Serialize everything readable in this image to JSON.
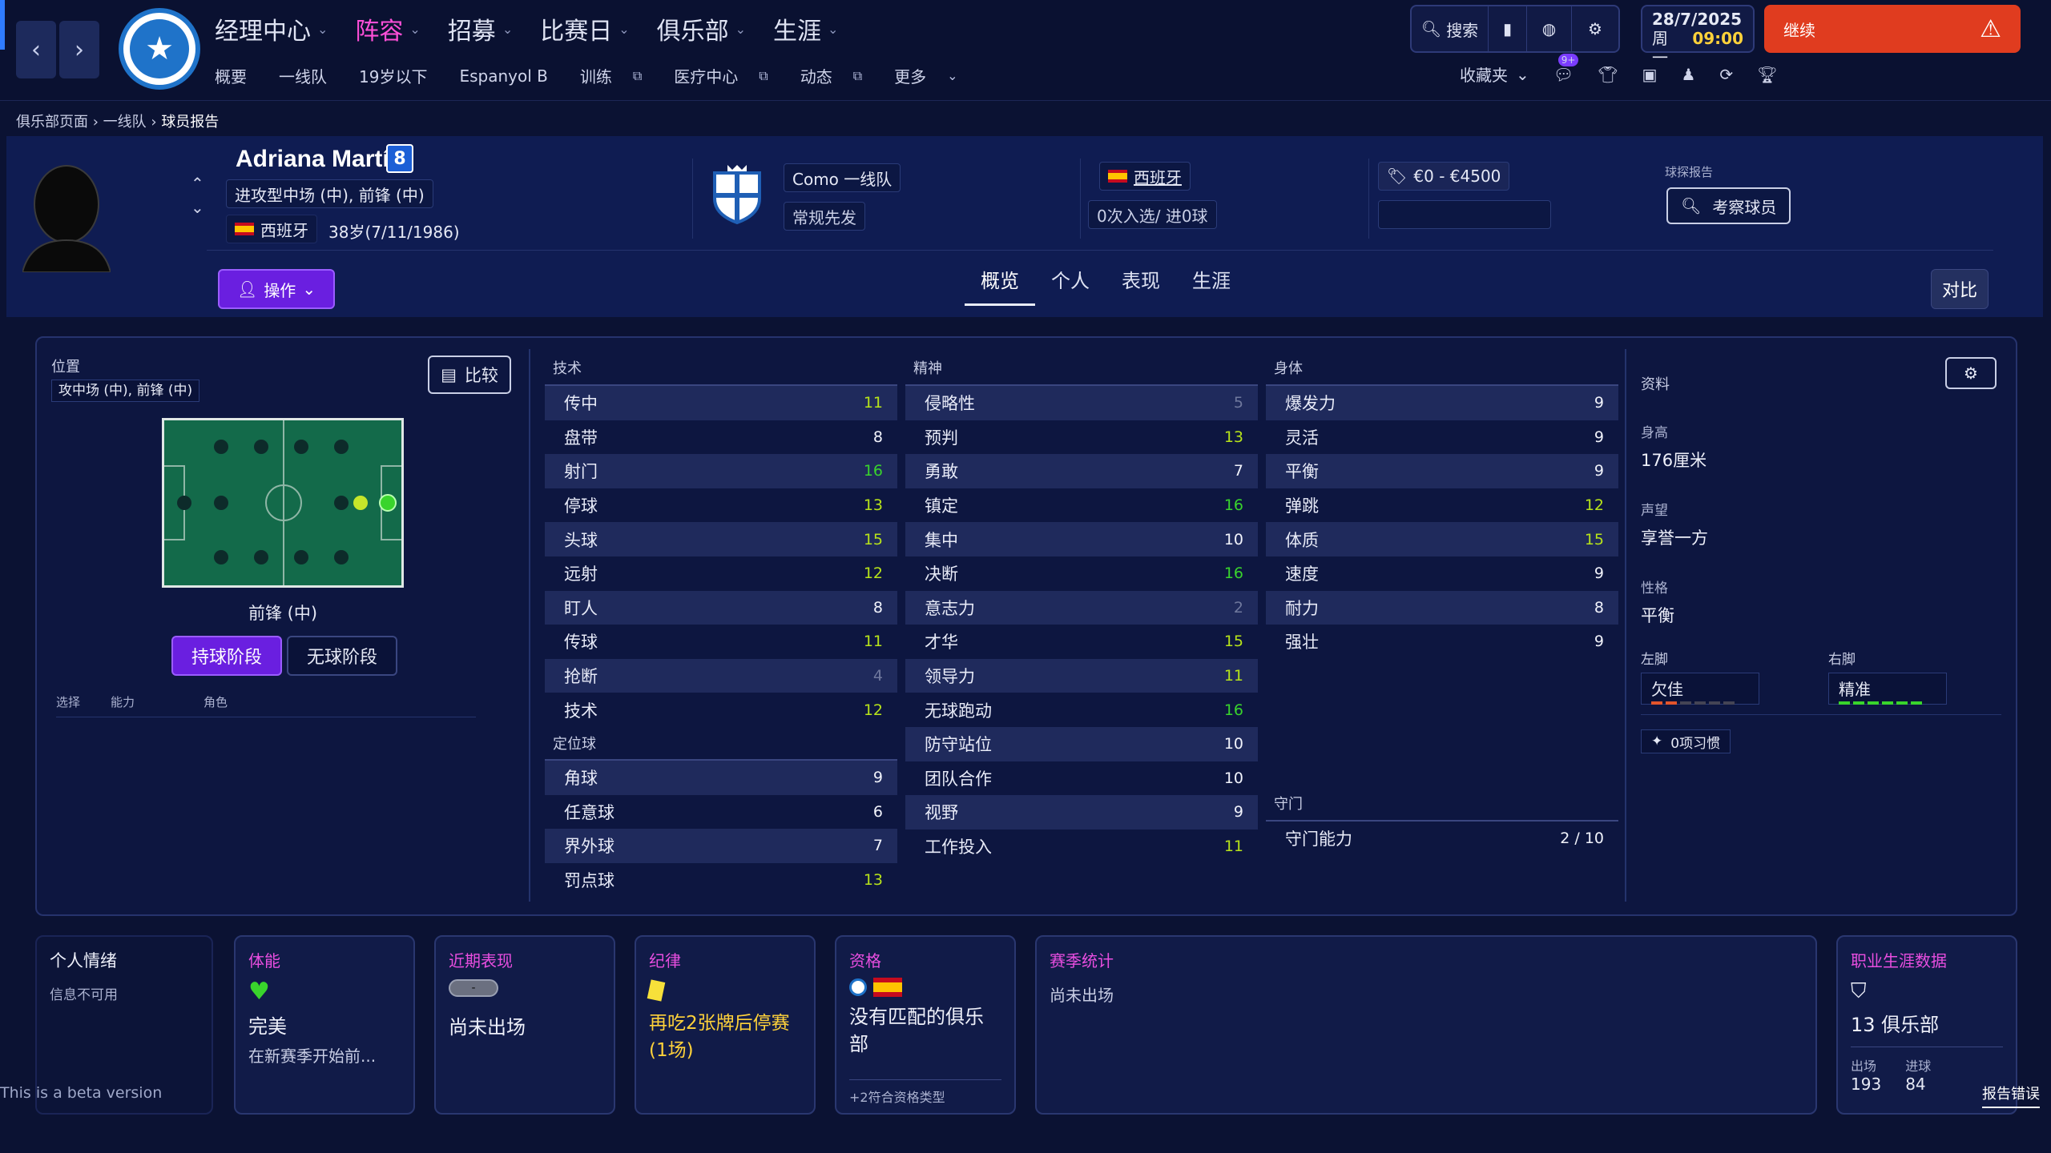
{
  "topbar": {
    "main_nav": [
      {
        "label": "经理中心",
        "active": false
      },
      {
        "label": "阵容",
        "active": true
      },
      {
        "label": "招募",
        "active": false
      },
      {
        "label": "比赛日",
        "active": false
      },
      {
        "label": "俱乐部",
        "active": false
      },
      {
        "label": "生涯",
        "active": false
      }
    ],
    "sub_nav": [
      "概要",
      "一线队",
      "19岁以下",
      "Espanyol B",
      "训练",
      "医疗中心",
      "动态",
      "更多"
    ],
    "search_label": "搜索",
    "date": "28/7/2025",
    "weekday": "周一",
    "time": "09:00",
    "continue_label": "继续",
    "favorites_label": "收藏夹",
    "notif_badge": "9+"
  },
  "breadcrumb": [
    "俱乐部页面",
    "一线队",
    "球员报告"
  ],
  "player": {
    "name": "Adriana Martín",
    "number": "8",
    "positions": "进攻型中场 (中), 前锋 (中)",
    "nationality": "西班牙",
    "age": "38岁(7/11/1986)",
    "club_team": "Como 一线队",
    "squad_status": "常规先发",
    "nation_label": "西班牙",
    "caps": "0次入选/ 进0球",
    "value": "€0 - €4500",
    "scout_report_label": "球探报告",
    "scout_button": "考察球员",
    "action_button": "操作"
  },
  "tabs": [
    "概览",
    "个人",
    "表现",
    "生涯"
  ],
  "compare_label": "对比",
  "position_panel": {
    "title": "位置",
    "positions_tag": "攻中场 (中), 前锋 (中)",
    "compare_button": "比较",
    "current_role": "前锋 (中)",
    "phase_in": "持球阶段",
    "phase_out": "无球阶段",
    "table_headers": [
      "选择",
      "能力",
      "角色"
    ]
  },
  "technical": {
    "title": "技术",
    "rows": [
      {
        "name": "传中",
        "value": "11",
        "tone": "lime"
      },
      {
        "name": "盘带",
        "value": "8",
        "tone": "white"
      },
      {
        "name": "射门",
        "value": "16",
        "tone": "green"
      },
      {
        "name": "停球",
        "value": "13",
        "tone": "lime"
      },
      {
        "name": "头球",
        "value": "15",
        "tone": "lime"
      },
      {
        "name": "远射",
        "value": "12",
        "tone": "lime"
      },
      {
        "name": "盯人",
        "value": "8",
        "tone": "white"
      },
      {
        "name": "传球",
        "value": "11",
        "tone": "lime"
      },
      {
        "name": "抢断",
        "value": "4",
        "tone": "dim"
      },
      {
        "name": "技术",
        "value": "12",
        "tone": "lime"
      }
    ],
    "set_piece_title": "定位球",
    "set_pieces": [
      {
        "name": "角球",
        "value": "9",
        "tone": "white"
      },
      {
        "name": "任意球",
        "value": "6",
        "tone": "white"
      },
      {
        "name": "界外球",
        "value": "7",
        "tone": "white"
      },
      {
        "name": "罚点球",
        "value": "13",
        "tone": "lime"
      }
    ]
  },
  "mental": {
    "title": "精神",
    "rows": [
      {
        "name": "侵略性",
        "value": "5",
        "tone": "dim"
      },
      {
        "name": "预判",
        "value": "13",
        "tone": "lime"
      },
      {
        "name": "勇敢",
        "value": "7",
        "tone": "white"
      },
      {
        "name": "镇定",
        "value": "16",
        "tone": "green"
      },
      {
        "name": "集中",
        "value": "10",
        "tone": "white"
      },
      {
        "name": "决断",
        "value": "16",
        "tone": "green"
      },
      {
        "name": "意志力",
        "value": "2",
        "tone": "dim"
      },
      {
        "name": "才华",
        "value": "15",
        "tone": "lime"
      },
      {
        "name": "领导力",
        "value": "11",
        "tone": "lime"
      },
      {
        "name": "无球跑动",
        "value": "16",
        "tone": "green"
      },
      {
        "name": "防守站位",
        "value": "10",
        "tone": "white"
      },
      {
        "name": "团队合作",
        "value": "10",
        "tone": "white"
      },
      {
        "name": "视野",
        "value": "9",
        "tone": "white"
      },
      {
        "name": "工作投入",
        "value": "11",
        "tone": "lime"
      }
    ]
  },
  "physical": {
    "title": "身体",
    "rows": [
      {
        "name": "爆发力",
        "value": "9",
        "tone": "white"
      },
      {
        "name": "灵活",
        "value": "9",
        "tone": "white"
      },
      {
        "name": "平衡",
        "value": "9",
        "tone": "white"
      },
      {
        "name": "弹跳",
        "value": "12",
        "tone": "lime"
      },
      {
        "name": "体质",
        "value": "15",
        "tone": "lime"
      },
      {
        "name": "速度",
        "value": "9",
        "tone": "white"
      },
      {
        "name": "耐力",
        "value": "8",
        "tone": "white"
      },
      {
        "name": "强壮",
        "value": "9",
        "tone": "white"
      }
    ],
    "gk_title": "守门",
    "gk_label": "守门能力",
    "gk_value": "2 / 10"
  },
  "info": {
    "title": "资料",
    "height_label": "身高",
    "height": "176厘米",
    "reputation_label": "声望",
    "reputation": "享誉一方",
    "personality_label": "性格",
    "personality": "平衡",
    "left_foot_label": "左脚",
    "left_foot": "欠佳",
    "right_foot_label": "右脚",
    "right_foot": "精准",
    "habits": "0项习惯"
  },
  "cards": {
    "morale_title": "个人情绪",
    "morale_value": "信息不可用",
    "fitness_title": "体能",
    "fitness_value": "完美",
    "fitness_sub": "在新赛季开始前...",
    "form_title": "近期表现",
    "form_pill": "-",
    "form_value": "尚未出场",
    "discipline_title": "纪律",
    "discipline_value": "再吃2张牌后停赛(1场)",
    "eligibility_title": "资格",
    "eligibility_value": "没有匹配的俱乐部",
    "eligibility_sub": "+2符合资格类型",
    "season_title": "赛季统计",
    "season_value": "尚未出场",
    "career_title": "职业生涯数据",
    "career_clubs": "13 俱乐部",
    "apps_label": "出场",
    "apps": "193",
    "goals_label": "进球",
    "goals": "84"
  },
  "beta_text": "This is a beta version",
  "report_bug": "报告错误"
}
